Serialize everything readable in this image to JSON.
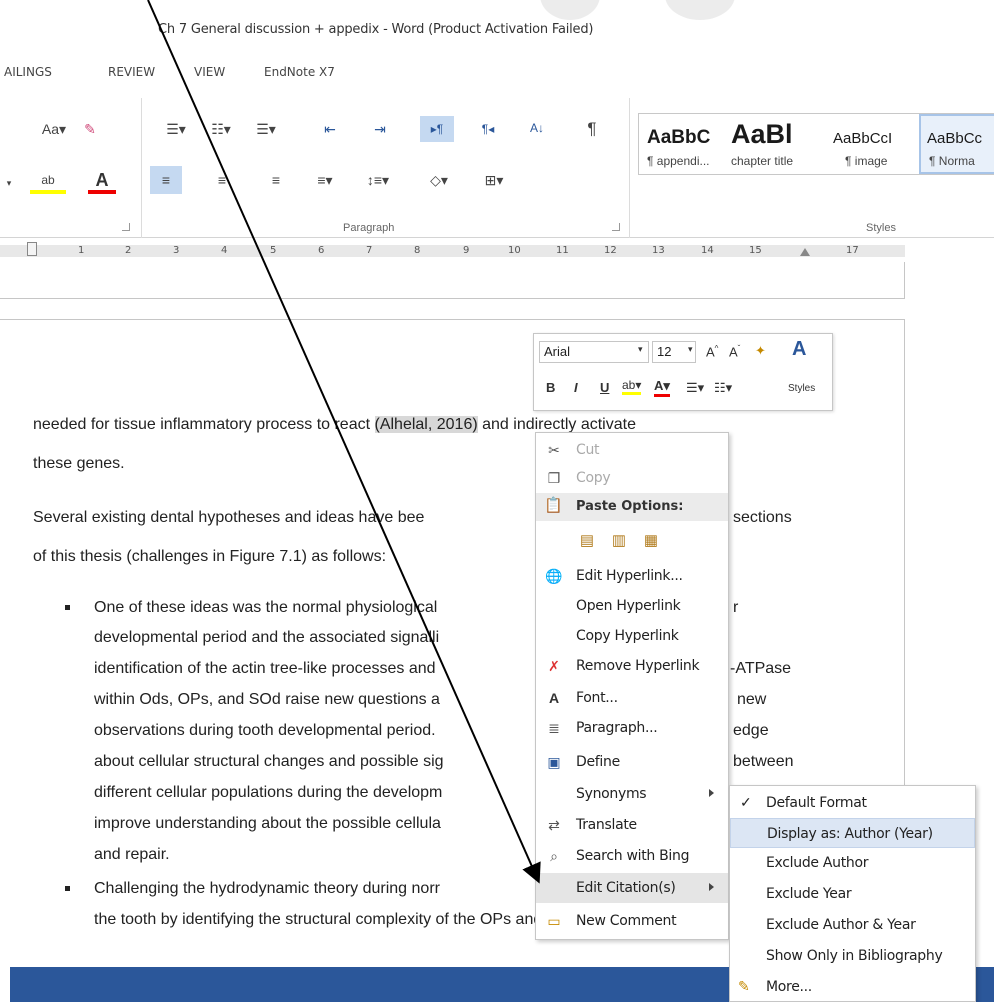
{
  "window": {
    "title": "Ch 7 General discussion + appedix - Word (Product Activation Failed)"
  },
  "tabs": [
    "AILINGS",
    "REVIEW",
    "VIEW",
    "EndNote X7"
  ],
  "ribbon": {
    "font_row1": [
      "Aa",
      "▾"
    ],
    "paragraph_label": "Paragraph",
    "styles_label": "Styles",
    "styles": [
      {
        "preview": "AaBbC",
        "name": "¶ appendi..."
      },
      {
        "preview": "AaBl",
        "name": "chapter title"
      },
      {
        "preview": "AaBbCcI",
        "name": "¶ image"
      },
      {
        "preview": "AaBbCc",
        "name": "¶ Norma"
      }
    ]
  },
  "ruler": {
    "numbers": [
      "1",
      "2",
      "3",
      "4",
      "5",
      "6",
      "7",
      "8",
      "9",
      "10",
      "11",
      "12",
      "13",
      "14",
      "15",
      "17"
    ]
  },
  "document": {
    "line1_a": "needed for tissue inflammatory process to react ",
    "citation": "(Alhelal, 2016)",
    "line1_b": " and indirectly activate",
    "line2": "these genes.",
    "line3a": "Several existing dental hypotheses and ideas have bee",
    "line3b": "sections",
    "line4": "of this thesis (challenges in Figure 7.1) as follows:",
    "b1_l1a": "One of these ideas was the normal physiological",
    "b1_l1b": "r",
    "b1_l2": "developmental period and the associated signalli",
    "b1_l3a": "identification of the actin tree-like processes and",
    "b1_l3b": "-ATPase",
    "b1_l4a": "within Ods, OPs, and SOd raise new questions a",
    "b1_l4b": "new",
    "b1_l5a": "observations during tooth developmental period.",
    "b1_l5b": "edge",
    "b1_l6a": "about cellular structural changes and possible sig",
    "b1_l6b": "between",
    "b1_l7": "different cellular populations during the developm",
    "b1_l8": "improve understanding about the possible cellula",
    "b1_l9": "and repair.",
    "b2_l1": "Challenging the hydrodynamic theory during norr",
    "b2_l2": "the tooth by identifying the structural complexity of the OPs and dentir"
  },
  "minitoolbar": {
    "font": "Arial",
    "size": "12",
    "styles_label": "Styles",
    "bold": "B",
    "italic": "I",
    "underline": "U"
  },
  "context_menu": {
    "cut": "Cut",
    "copy": "Copy",
    "paste_options": "Paste Options:",
    "edit_hyperlink": "Edit Hyperlink...",
    "open_hyperlink": "Open Hyperlink",
    "copy_hyperlink": "Copy Hyperlink",
    "remove_hyperlink": "Remove Hyperlink",
    "font": "Font...",
    "paragraph": "Paragraph...",
    "define": "Define",
    "synonyms": "Synonyms",
    "translate": "Translate",
    "search_bing": "Search with Bing",
    "edit_citation": "Edit Citation(s)",
    "new_comment": "New Comment"
  },
  "submenu": {
    "default_format": "Default Format",
    "display_author_year": "Display as: Author (Year)",
    "exclude_author": "Exclude Author",
    "exclude_year": "Exclude Year",
    "exclude_author_year": "Exclude Author & Year",
    "show_only_bib": "Show Only in Bibliography",
    "more": "More..."
  },
  "colors": {
    "accent": "#2b579a",
    "hover": "#e5e5e5",
    "submenu_hover": "#dce6f4"
  }
}
